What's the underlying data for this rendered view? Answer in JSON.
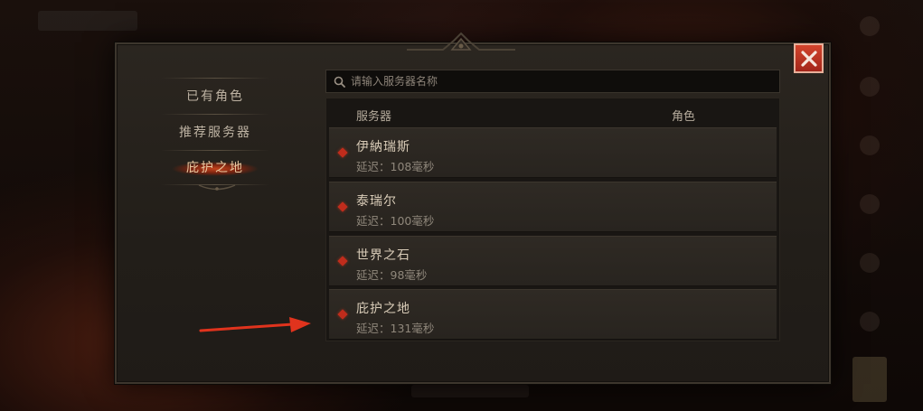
{
  "search": {
    "placeholder": "请输入服务器名称"
  },
  "menu": {
    "items": [
      {
        "label": "已有角色",
        "active": false
      },
      {
        "label": "推荐服务器",
        "active": false
      },
      {
        "label": "庇护之地",
        "active": true
      }
    ]
  },
  "list": {
    "headers": {
      "server": "服务器",
      "role": "角色"
    },
    "rows": [
      {
        "name": "伊納瑞斯",
        "latency": "延迟：108毫秒"
      },
      {
        "name": "泰瑞尔",
        "latency": "延迟：100毫秒"
      },
      {
        "name": "世界之石",
        "latency": "延迟：98毫秒"
      },
      {
        "name": "庇护之地",
        "latency": "延迟：131毫秒"
      }
    ]
  },
  "colors": {
    "accent_red": "#c02c1c",
    "close_button": "#b8301f",
    "annotation_arrow": "#e0331d"
  },
  "icons": {
    "close": "close-icon",
    "search": "search-icon",
    "row_marker": "diamond-icon",
    "annotation": "arrow-icon"
  }
}
